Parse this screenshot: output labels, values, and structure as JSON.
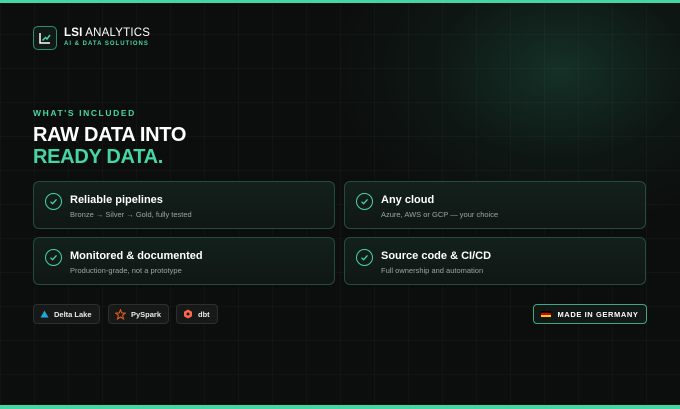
{
  "brand": {
    "name_bold": "LSI",
    "name_rest": " ANALYTICS",
    "tagline": "AI & DATA SOLUTIONS",
    "logo_icon": "chart-line-icon"
  },
  "hero": {
    "eyebrow": "WHAT'S INCLUDED",
    "line1": "RAW DATA INTO",
    "line2": "READY DATA."
  },
  "features": [
    {
      "title": "Reliable pipelines",
      "subtitle": "Bronze → Silver → Gold, fully tested",
      "icon": "check-circle-icon"
    },
    {
      "title": "Any cloud",
      "subtitle": "Azure, AWS or GCP — your choice",
      "icon": "check-circle-icon"
    },
    {
      "title": "Monitored & documented",
      "subtitle": "Production-grade, not a prototype",
      "icon": "check-circle-icon"
    },
    {
      "title": "Source code & CI/CD",
      "subtitle": "Full ownership and automation",
      "icon": "check-circle-icon"
    }
  ],
  "tech": [
    {
      "label": "Delta Lake",
      "icon": "triangle-icon"
    },
    {
      "label": "PySpark",
      "icon": "star-icon"
    },
    {
      "label": "dbt",
      "icon": "hexagon-icon"
    }
  ],
  "badge": {
    "label": "MADE IN GERMANY",
    "icon": "german-flag-icon"
  },
  "colors": {
    "accent": "#45d6a4",
    "background": "#0c0e0d",
    "card_border": "#244b3d",
    "flag_black": "#000000",
    "flag_red": "#dd0000",
    "flag_gold": "#ffce00"
  }
}
